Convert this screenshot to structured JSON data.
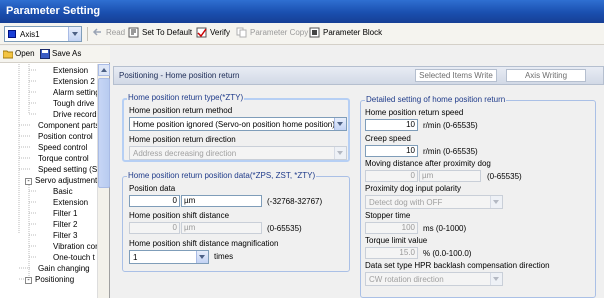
{
  "window": {
    "title": "Parameter Setting"
  },
  "toolbar": {
    "axis_value": "Axis1",
    "read": "Read",
    "set_to_default": "Set To Default",
    "verify": "Verify",
    "parameter_copy": "Parameter Copy",
    "parameter_block": "Parameter Block"
  },
  "tree_toolbar": {
    "open": "Open",
    "save_as": "Save As"
  },
  "tree": [
    {
      "label": "Extension",
      "expander": ""
    },
    {
      "label": "Extension 2",
      "expander": ""
    },
    {
      "label": "Alarm setting",
      "expander": ""
    },
    {
      "label": "Tough drive",
      "expander": ""
    },
    {
      "label": "Drive recorder",
      "expander": ""
    },
    {
      "label": "Component parts",
      "expander": ""
    },
    {
      "label": "Position control",
      "expander": ""
    },
    {
      "label": "Speed control",
      "expander": ""
    },
    {
      "label": "Torque control",
      "expander": ""
    },
    {
      "label": "Speed setting (Sp",
      "expander": ""
    },
    {
      "label": "Servo adjustment",
      "expander": "-"
    },
    {
      "label": "Basic",
      "expander": ""
    },
    {
      "label": "Extension",
      "expander": ""
    },
    {
      "label": "Filter 1",
      "expander": ""
    },
    {
      "label": "Filter 2",
      "expander": ""
    },
    {
      "label": "Filter 3",
      "expander": ""
    },
    {
      "label": "Vibration cont",
      "expander": ""
    },
    {
      "label": "One-touch t",
      "expander": ""
    },
    {
      "label": "Gain changing",
      "expander": ""
    },
    {
      "label": "Positioning",
      "expander": "-"
    }
  ],
  "panel": {
    "title": "Positioning - Home position return",
    "selected_items_write": "Selected Items Write",
    "axis_writing": "Axis Writing"
  },
  "group_type": {
    "title": "Home position return type(*ZTY)",
    "method_label": "Home position return method",
    "method_value": "Home position ignored (Servo-on position home position)",
    "direction_label": "Home position return direction",
    "direction_value": "Address decreasing direction"
  },
  "group_data": {
    "title": "Home position return position data(*ZPS, ZST, *ZTY)",
    "position_label": "Position data",
    "position_value": "0",
    "position_unit": "µm",
    "position_range": "(-32768-32767)",
    "shift_label": "Home position shift distance",
    "shift_value": "0",
    "shift_unit": "µm",
    "shift_range": "(0-65535)",
    "mag_label": "Home position shift distance magnification",
    "mag_value": "1",
    "mag_unit": "times"
  },
  "group_detail": {
    "title": "Detailed setting of home position return",
    "speed_label": "Home position return speed",
    "speed_value": "10",
    "speed_unit": "r/min (0-65535)",
    "creep_label": "Creep speed",
    "creep_value": "10",
    "creep_unit": "r/min (0-65535)",
    "move_label": "Moving distance after proximity dog",
    "move_value": "0",
    "move_unit": "µm",
    "move_range": "(0-65535)",
    "polarity_label": "Proximity dog input polarity",
    "polarity_value": "Detect dog with OFF",
    "stopper_label": "Stopper time",
    "stopper_value": "100",
    "stopper_unit": "ms (0-1000)",
    "torque_label": "Torque limit value",
    "torque_value": "15.0",
    "torque_unit": "% (0.0-100.0)",
    "backlash_label": "Data set type HPR backlash compensation direction",
    "backlash_value": "CW rotation direction"
  }
}
